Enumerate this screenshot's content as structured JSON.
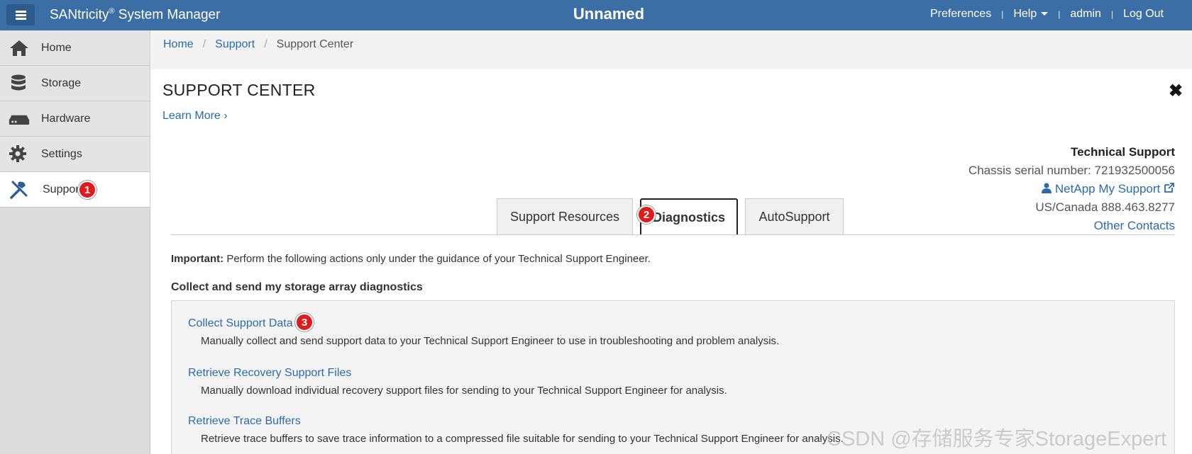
{
  "header": {
    "brand": "SANtricity",
    "brand_reg": "®",
    "brand_suffix": " System Manager",
    "system_name": "Unnamed",
    "nav": {
      "preferences": "Preferences",
      "help": "Help",
      "user": "admin",
      "logout": "Log Out"
    },
    "color": "#3a6ea5"
  },
  "sidebar": {
    "items": [
      {
        "label": "Home",
        "icon": "home-icon"
      },
      {
        "label": "Storage",
        "icon": "database-icon"
      },
      {
        "label": "Hardware",
        "icon": "hardware-icon"
      },
      {
        "label": "Settings",
        "icon": "gear-icon"
      },
      {
        "label": "Support",
        "icon": "tools-icon",
        "active": true
      }
    ]
  },
  "breadcrumb": {
    "home": "Home",
    "support": "Support",
    "current": "Support Center"
  },
  "page": {
    "title": "SUPPORT CENTER",
    "learn_more": "Learn More",
    "close_icon": "close-icon"
  },
  "tech_support": {
    "title": "Technical Support",
    "serial": "Chassis serial number: 721932500056",
    "my_support": "NetApp My Support",
    "phone": "US/Canada 888.463.8277",
    "other_contacts": "Other Contacts"
  },
  "tabs": [
    "Support Resources",
    "Diagnostics",
    "AutoSupport"
  ],
  "active_tab": "Diagnostics",
  "important": {
    "label": "Important:",
    "text": " Perform the following actions only under the guidance of your Technical Support Engineer."
  },
  "section_heading": "Collect and send my storage array diagnostics",
  "actions": [
    {
      "title": "Collect Support Data",
      "desc": "Manually collect and send support data to your Technical Support Engineer to use in troubleshooting and problem analysis."
    },
    {
      "title": "Retrieve Recovery Support Files",
      "desc": "Manually download individual recovery support files for sending to your Technical Support Engineer for analysis."
    },
    {
      "title": "Retrieve Trace Buffers",
      "desc": "Retrieve trace buffers to save trace information to a compressed file suitable for sending to your Technical Support Engineer for analysis."
    }
  ],
  "annotations": {
    "one": "1",
    "two": "2",
    "three": "3"
  },
  "watermark": "CSDN @存储服务专家StorageExpert"
}
